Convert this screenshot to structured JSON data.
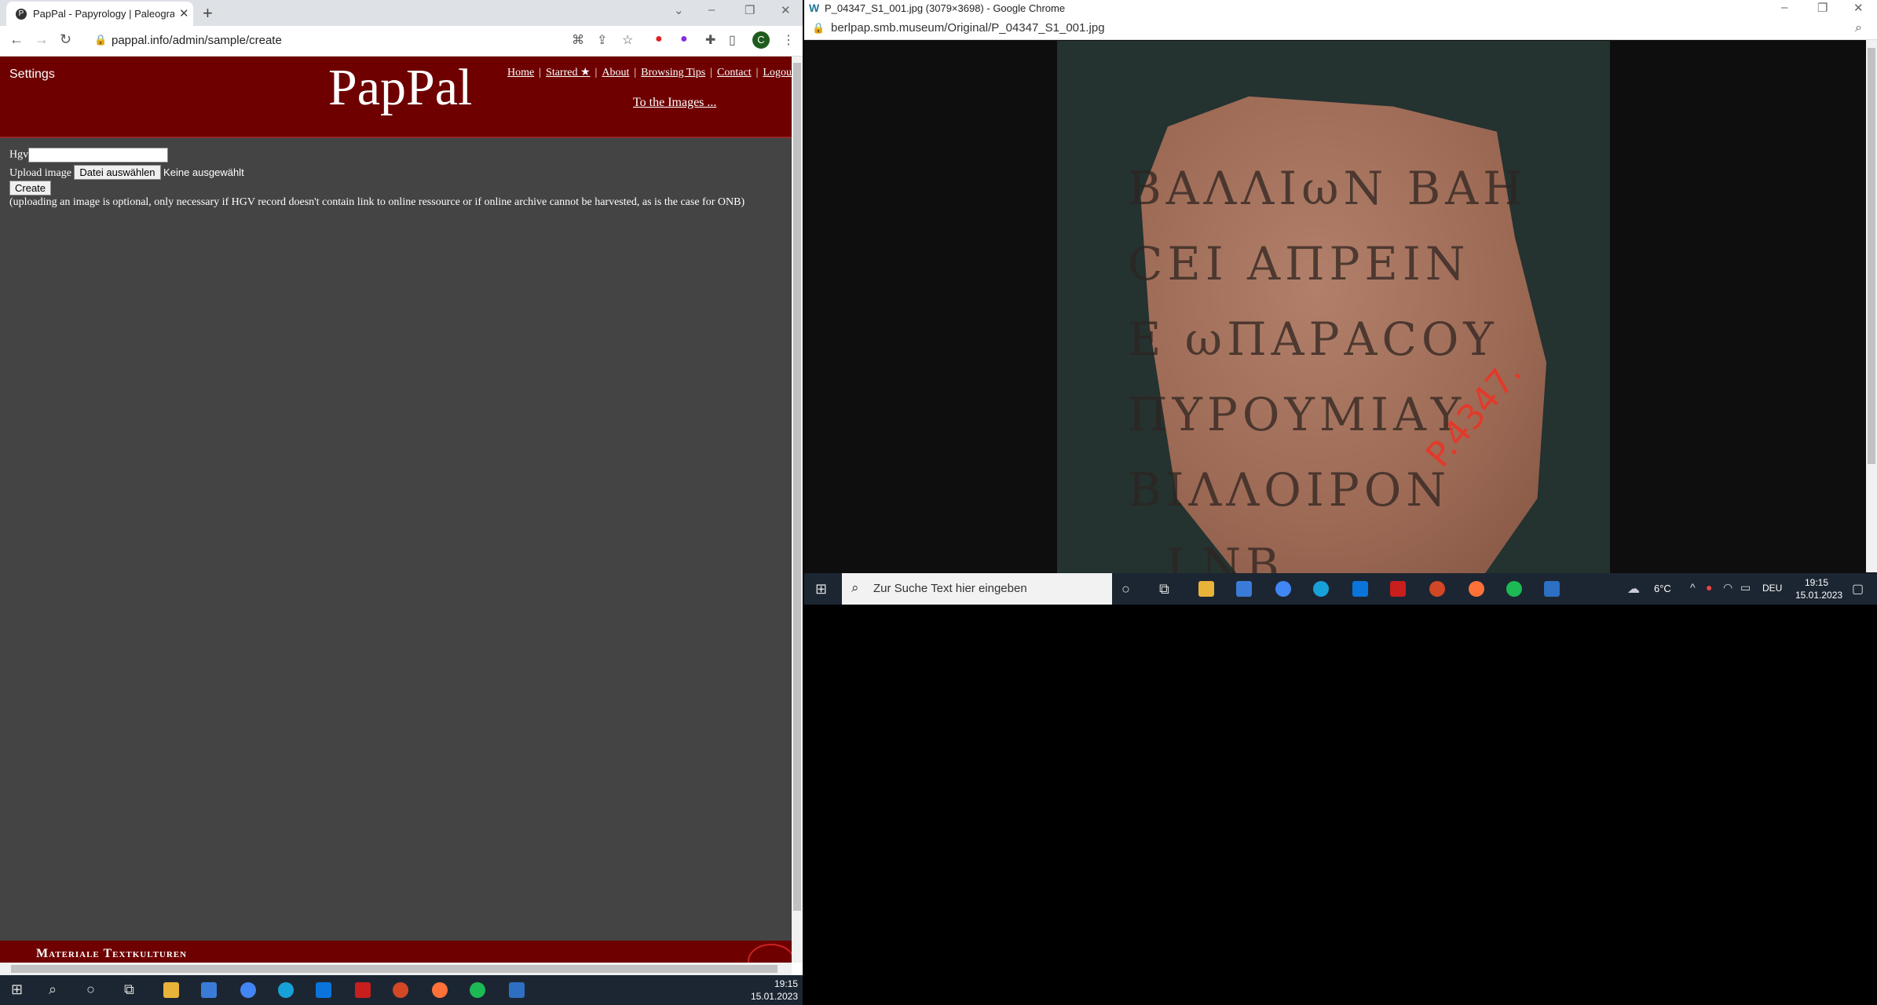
{
  "left_browser": {
    "tab_title": "PapPal - Papyrology | Paleograph",
    "url": "pappal.info/admin/sample/create",
    "profile_initial": "C"
  },
  "page": {
    "settings": "Settings",
    "logo": "PapPal",
    "nav": [
      "Home",
      "Starred ★",
      "About",
      "Browsing Tips",
      "Contact",
      "Logout"
    ],
    "to_images": "To the Images ...",
    "form": {
      "hgv_label": "Hgv",
      "upload_label": "Upload image",
      "file_button": "Datei auswählen",
      "no_file": "Keine ausgewählt",
      "create_button": "Create",
      "note": "(uploading an image is optional, only necessary if HGV record doesn't contain link to online ressource or if online archive cannot be harvested, as is the case for ONB)"
    },
    "footer": "Materiale Textkulturen"
  },
  "right_browser": {
    "title": "P_04347_S1_001.jpg (3079×3698) - Google Chrome",
    "url": "berlpap.smb.museum/Original/P_04347_S1_001.jpg",
    "photo_inventory_mark": "P.4347."
  },
  "right_taskbar": {
    "search_placeholder": "Zur Suche Text hier eingeben",
    "weather": "6°C",
    "language": "DEU",
    "time": "19:15",
    "date": "15.01.2023"
  },
  "bottom_taskbar": {
    "time": "19:15",
    "date": "15.01.2023"
  },
  "colors": {
    "header_red": "#6e0000",
    "page_gray": "#444444",
    "taskbar": "#1c2632"
  }
}
